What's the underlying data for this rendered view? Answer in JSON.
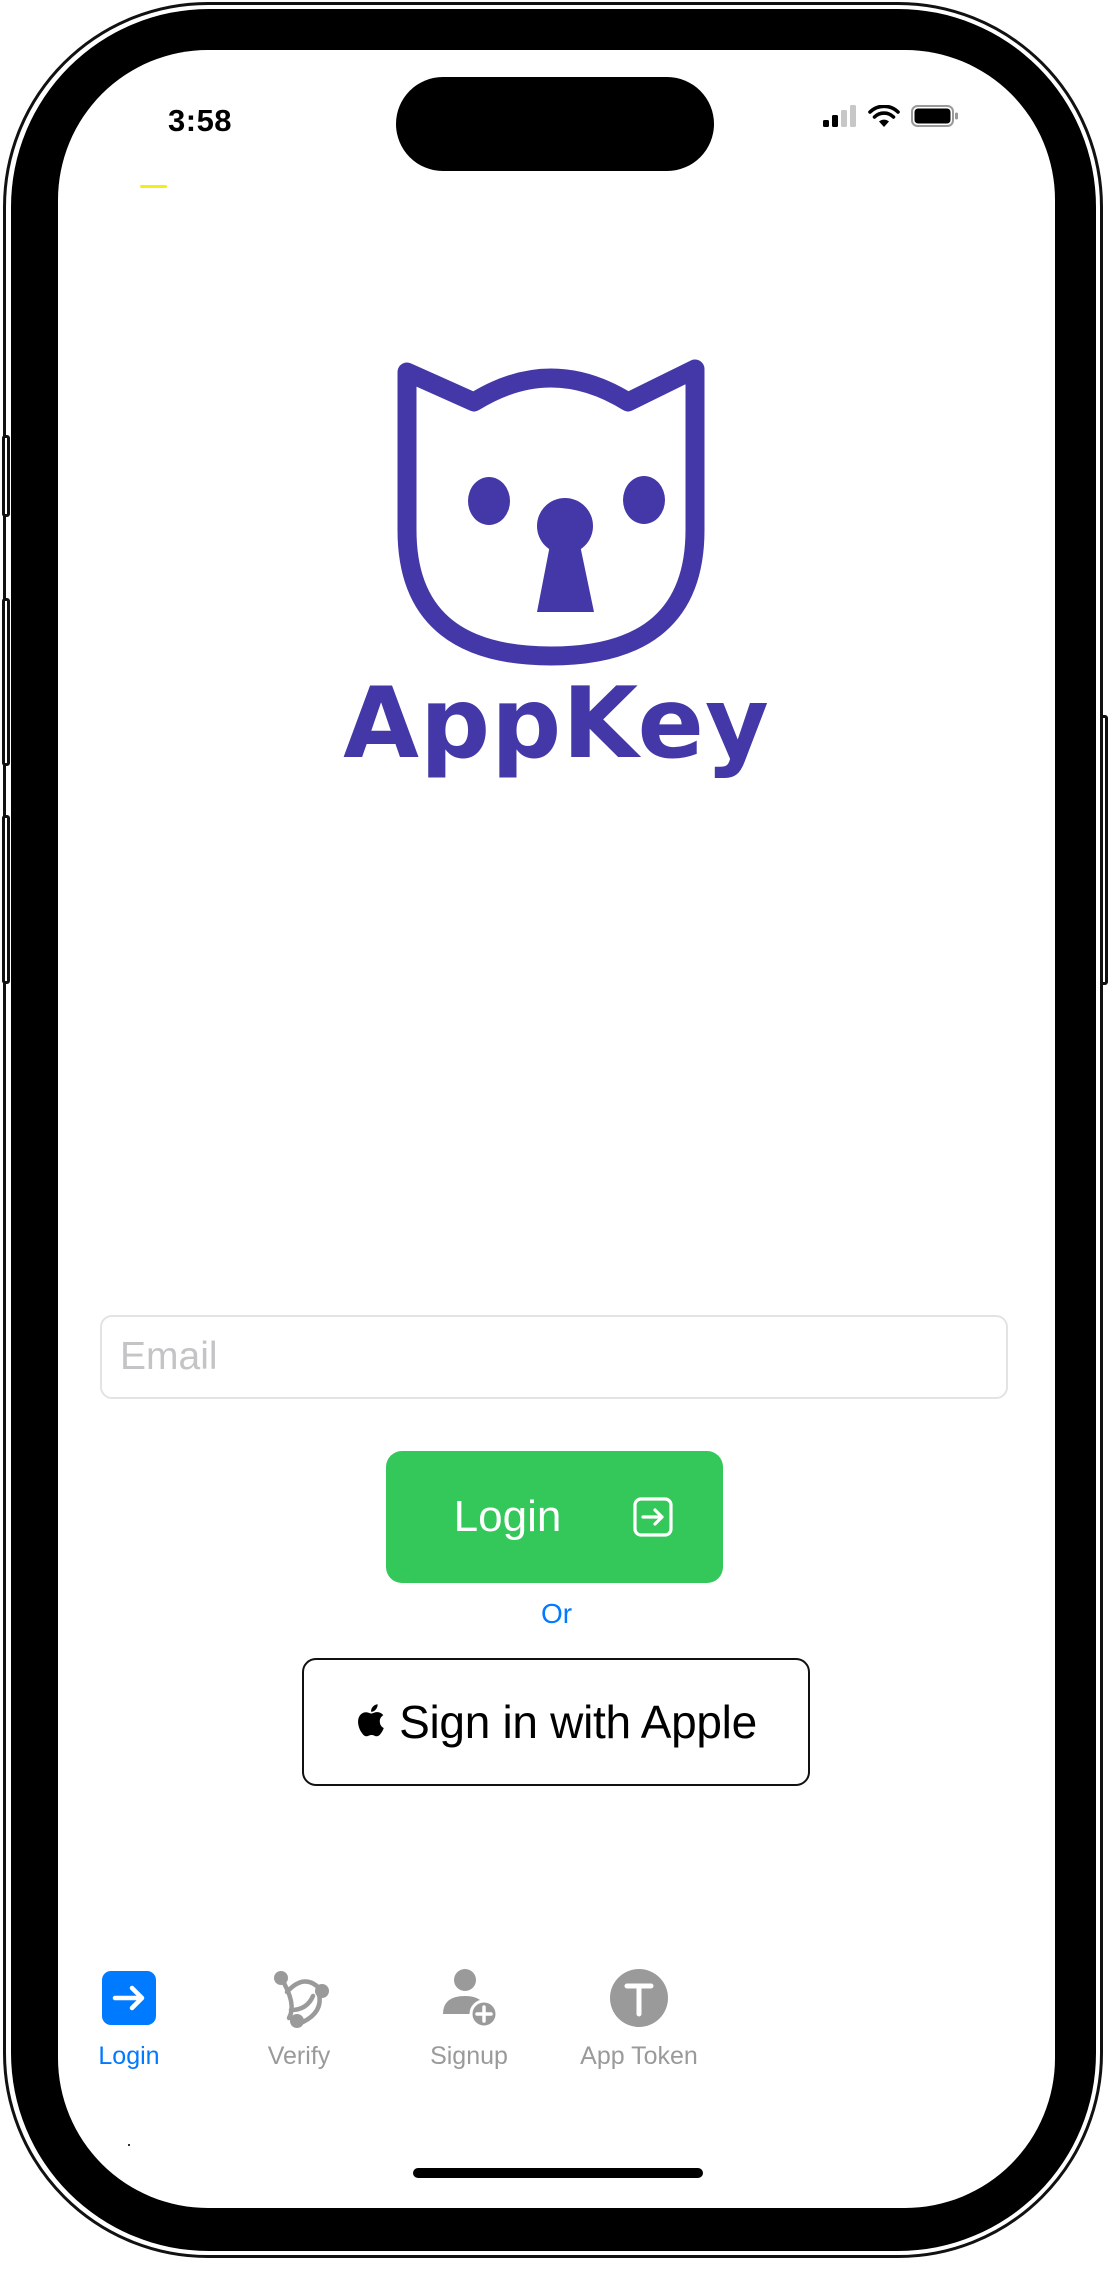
{
  "status_bar": {
    "time": "3:58",
    "signal_bars_filled": 2,
    "signal_bars_total": 4,
    "wifi": "wifi-icon",
    "battery_level": 1.0
  },
  "brand": {
    "name": "AppKey",
    "logo": "cat-keyhole-logo",
    "color": "#4438A8"
  },
  "form": {
    "email": {
      "value": "",
      "placeholder": "Email"
    },
    "login_button": {
      "label": "Login",
      "icon": "arrow-right-square-icon",
      "color": "#34C759"
    },
    "or_label": "Or",
    "apple_button": {
      "label": "Sign in with Apple",
      "icon": "apple-logo-icon"
    }
  },
  "tabbar": {
    "active_color": "#007AFF",
    "inactive_color": "#999999",
    "items": [
      {
        "label": "Login",
        "icon": "arrow-right-square-icon",
        "active": true
      },
      {
        "label": "Verify",
        "icon": "three-nodes-connected-icon",
        "active": false
      },
      {
        "label": "Signup",
        "icon": "person-badge-plus-icon",
        "active": false
      },
      {
        "label": "App Token",
        "icon": "token-t-circle-icon",
        "active": false
      }
    ]
  }
}
